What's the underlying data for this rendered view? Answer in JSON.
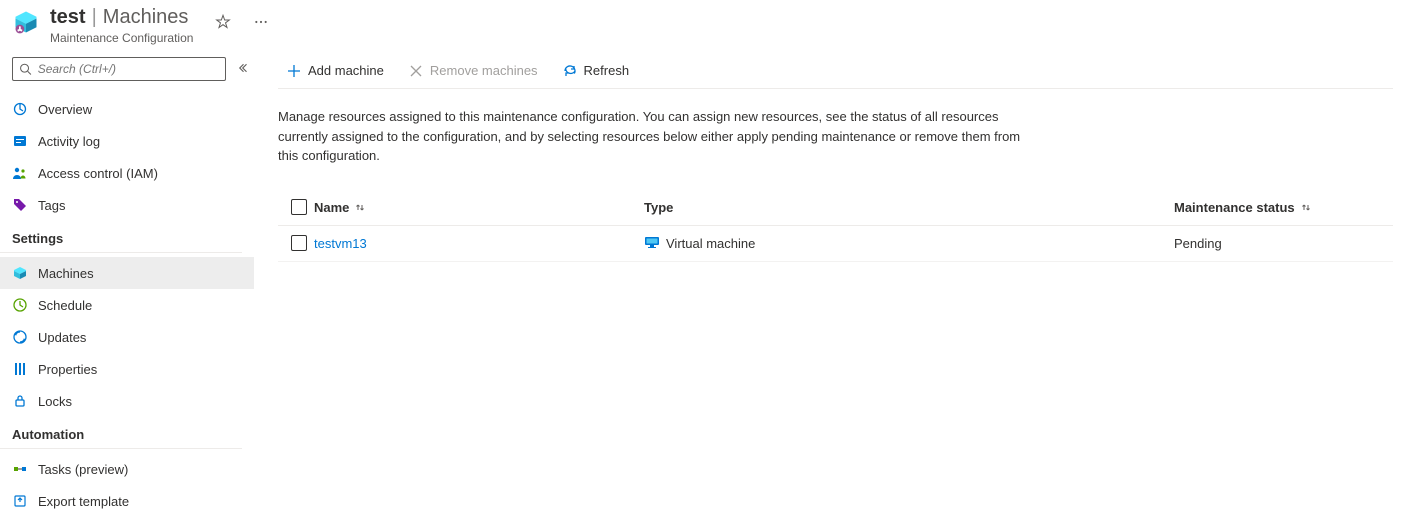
{
  "header": {
    "title": "test",
    "separator": "|",
    "section": "Machines",
    "subtitle": "Maintenance Configuration"
  },
  "search": {
    "placeholder": "Search (Ctrl+/)"
  },
  "nav": {
    "top": [
      {
        "key": "overview",
        "label": "Overview"
      },
      {
        "key": "activity-log",
        "label": "Activity log"
      },
      {
        "key": "access-control",
        "label": "Access control (IAM)"
      },
      {
        "key": "tags",
        "label": "Tags"
      }
    ],
    "groups": [
      {
        "label": "Settings",
        "items": [
          {
            "key": "machines",
            "label": "Machines",
            "selected": true
          },
          {
            "key": "schedule",
            "label": "Schedule"
          },
          {
            "key": "updates",
            "label": "Updates"
          },
          {
            "key": "properties",
            "label": "Properties"
          },
          {
            "key": "locks",
            "label": "Locks"
          }
        ]
      },
      {
        "label": "Automation",
        "items": [
          {
            "key": "tasks",
            "label": "Tasks (preview)"
          },
          {
            "key": "export-template",
            "label": "Export template"
          }
        ]
      }
    ]
  },
  "toolbar": {
    "add": "Add machine",
    "remove": "Remove machines",
    "refresh": "Refresh"
  },
  "description": "Manage resources assigned to this maintenance configuration. You can assign new resources, see the status of all resources currently assigned to the configuration, and by selecting resources below either apply pending maintenance or remove them from this configuration.",
  "table": {
    "headers": {
      "name": "Name",
      "type": "Type",
      "status": "Maintenance status"
    },
    "rows": [
      {
        "name": "testvm13",
        "type": "Virtual machine",
        "status": "Pending"
      }
    ]
  }
}
